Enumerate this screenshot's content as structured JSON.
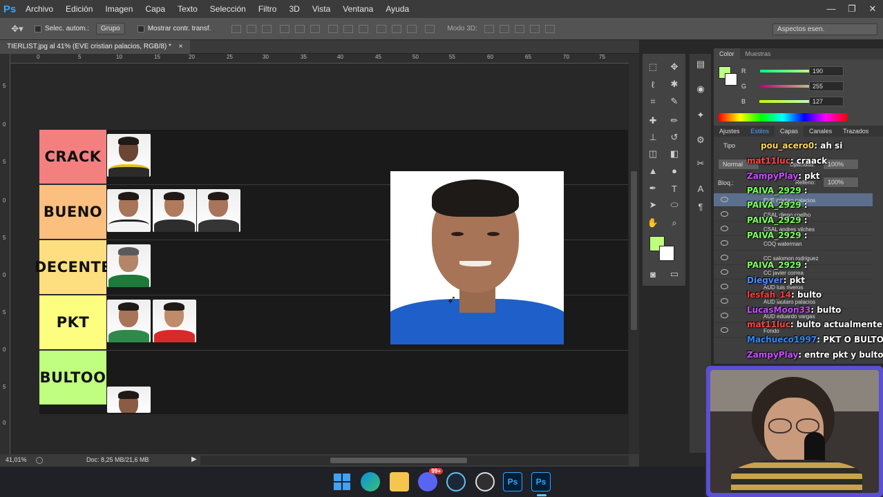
{
  "app": {
    "logo": "Ps"
  },
  "menu": [
    "Archivo",
    "Edición",
    "Imagen",
    "Capa",
    "Texto",
    "Selección",
    "Filtro",
    "3D",
    "Vista",
    "Ventana",
    "Ayuda"
  ],
  "window_controls": [
    "—",
    "❐",
    "✕"
  ],
  "options": {
    "auto_select_label": "Selec. autom.:",
    "group_value": "Grupo",
    "transform_label": "Mostrar contr. transf.",
    "mode3d_label": "Modo 3D:",
    "workspace_value": "Aspectos esen."
  },
  "document": {
    "tab_title": "TIERLIST.jpg al 41% (EVE cristian palacios, RGB/8) *",
    "close": "×"
  },
  "ruler_h": [
    "0",
    "5",
    "10",
    "15",
    "20",
    "25",
    "30",
    "35",
    "40",
    "45",
    "50",
    "55",
    "60",
    "65",
    "70",
    "75"
  ],
  "ruler_v": [
    "5",
    "0",
    "5",
    "0",
    "5",
    "0",
    "5",
    "0",
    "5",
    "0",
    "5",
    "0"
  ],
  "tiers": [
    {
      "label": "CRACK",
      "color": "#f47f7f",
      "players": 1
    },
    {
      "label": "BUENO",
      "color": "#fbbf7f",
      "players": 3
    },
    {
      "label": "DECENTE",
      "color": "#fddf7f",
      "players": 1
    },
    {
      "label": "PKT",
      "color": "#fdfe7f",
      "players": 2
    },
    {
      "label": "BULTOO",
      "color": "#bffe7f",
      "players": 1
    }
  ],
  "status": {
    "zoom": "41,01%",
    "doc": "Doc: 8,25 MB/21,6 MB"
  },
  "color_panel": {
    "tabs": [
      "Color",
      "Muestras"
    ],
    "r_label": "R",
    "g_label": "G",
    "b_label": "B",
    "r": "190",
    "g": "255",
    "b": "127",
    "fg_color": "#beff7f"
  },
  "layers_panel": {
    "tabs": [
      "Ajustes",
      "Estilos",
      "Capas",
      "Canales",
      "Trazados"
    ],
    "kind_label": "Tipo",
    "blend_mode": "Normal",
    "opacity_label": "Opacidad:",
    "opacity": "100%",
    "lock_label": "Bloq.:",
    "fill_label": "Relleno:",
    "fill": "100%",
    "layers": [
      "EVE cristian palacios",
      "CSAL diego coelho",
      "CSAL andres vilches",
      "COQ waterman",
      "CC salomon rodriguez",
      "CC javier correa",
      "AUD luis riveros",
      "AUD lautaro palacios",
      "AUD eduardo vargas",
      "Fondo"
    ]
  },
  "chat": [
    {
      "user": "pou_acero0",
      "text": ": ah si",
      "color": "#ffd84d"
    },
    {
      "user": "mat11luc",
      "text": ": craack",
      "color": "#ff4444"
    },
    {
      "user": "ZampyPlay",
      "text": ": pkt",
      "color": "#c74dff"
    },
    {
      "user": "PAIVA_2929",
      "text": " :",
      "color": "#7dff5c"
    },
    {
      "user": "PAIVA_2929",
      "text": " :",
      "color": "#7dff5c"
    },
    {
      "user": "PAIVA_2929",
      "text": " :",
      "color": "#7dff5c"
    },
    {
      "user": "PAIVA_2929",
      "text": " :",
      "color": "#7dff5c"
    },
    {
      "user": "PAIVA_2929",
      "text": " :",
      "color": "#7dff5c"
    },
    {
      "user": "Diegver",
      "text": ": pkt",
      "color": "#4d8cff"
    },
    {
      "user": "lesfah_14",
      "text": ": bulto",
      "color": "#ff3b3b"
    },
    {
      "user": "LucasMoon33",
      "text": ": bulto",
      "color": "#c74dff"
    },
    {
      "user": "mat11luc",
      "text": ": bulto actualmente",
      "color": "#ff4444"
    },
    {
      "user": "Machueco1997",
      "text": ": PKT O BULTO",
      "color": "#2d89ff"
    },
    {
      "user": "ZampyPlay",
      "text": ": entre pkt y bulto",
      "color": "#c74dff"
    }
  ],
  "taskbar": {
    "apps": [
      "windows-start",
      "edge",
      "explorer",
      "discord",
      "steam",
      "obs",
      "photoshop",
      "photoshop-active"
    ],
    "discord_badge": "99+"
  }
}
